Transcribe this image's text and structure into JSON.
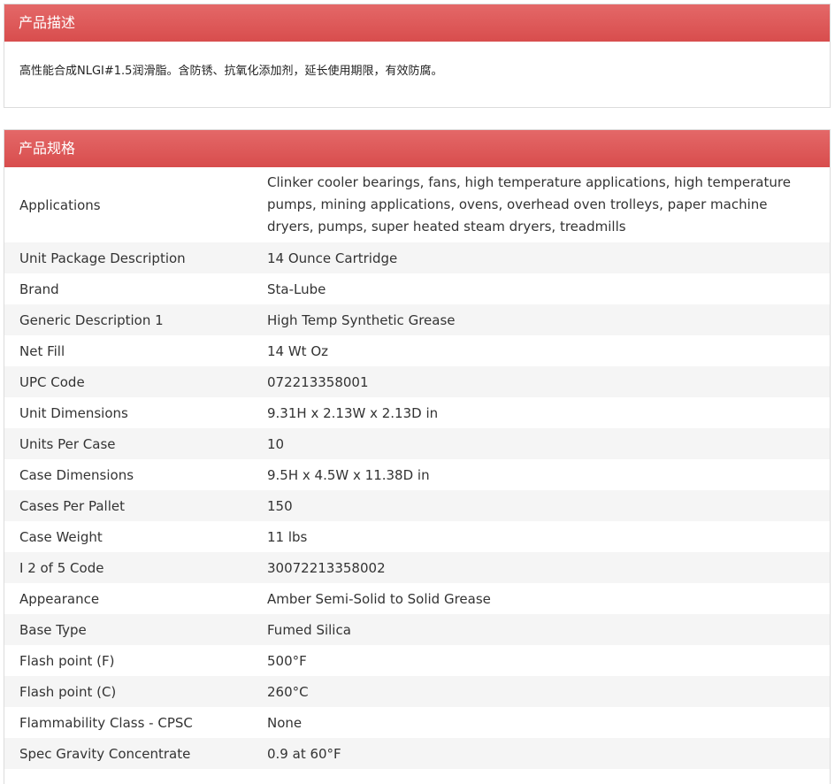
{
  "description": {
    "title": "产品描述",
    "text": "高性能合成NLGI#1.5润滑脂。含防锈、抗氧化添加剂，延长使用期限，有效防腐。"
  },
  "spec": {
    "title": "产品规格",
    "rows": [
      {
        "key": "Applications",
        "value": "Clinker cooler bearings, fans, high temperature applications, high temperature pumps, mining applications, ovens, overhead oven trolleys, paper machine dryers, pumps, super heated steam dryers, treadmills"
      },
      {
        "key": "Unit Package Description",
        "value": "14 Ounce Cartridge"
      },
      {
        "key": "Brand",
        "value": "Sta-Lube"
      },
      {
        "key": "Generic Description 1",
        "value": "High Temp Synthetic Grease"
      },
      {
        "key": "Net Fill",
        "value": "14 Wt Oz"
      },
      {
        "key": "UPC Code",
        "value": "072213358001"
      },
      {
        "key": "Unit Dimensions",
        "value": "9.31H x 2.13W x 2.13D in"
      },
      {
        "key": "Units Per Case",
        "value": "10"
      },
      {
        "key": "Case Dimensions",
        "value": "9.5H x 4.5W x 11.38D in"
      },
      {
        "key": "Cases Per Pallet",
        "value": "150"
      },
      {
        "key": "Case Weight",
        "value": "11 lbs"
      },
      {
        "key": "I 2 of 5 Code",
        "value": "30072213358002"
      },
      {
        "key": "Appearance",
        "value": "Amber Semi-Solid to Solid Grease"
      },
      {
        "key": "Base Type",
        "value": "Fumed Silica"
      },
      {
        "key": "Flash point (F)",
        "value": "500°F"
      },
      {
        "key": "Flash point (C)",
        "value": "260°C"
      },
      {
        "key": "Flammability Class - CPSC",
        "value": "None"
      },
      {
        "key": "Spec Gravity Concentrate",
        "value": "0.9 at 60°F"
      }
    ]
  }
}
